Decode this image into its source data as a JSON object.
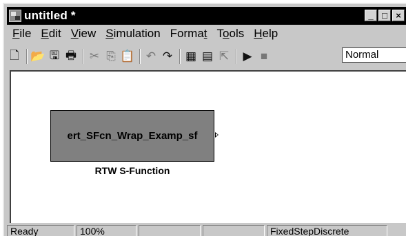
{
  "window": {
    "title": "untitled *",
    "controls": {
      "minimize": "_",
      "maximize": "□",
      "close": "×"
    }
  },
  "menu": [
    "File",
    "Edit",
    "View",
    "Simulation",
    "Format",
    "Tools",
    "Help"
  ],
  "menu_access": [
    "F",
    "E",
    "V",
    "S",
    "t",
    "o",
    "H"
  ],
  "toolbar": {
    "icons": [
      {
        "name": "new-model-icon",
        "glyph": "🗋"
      },
      {
        "name": "open-icon",
        "glyph": "📂"
      },
      {
        "name": "save-icon",
        "glyph": "🖫"
      },
      {
        "name": "print-icon",
        "glyph": "🖶"
      },
      {
        "name": "cut-icon",
        "glyph": "✂"
      },
      {
        "name": "copy-icon",
        "glyph": "⎘"
      },
      {
        "name": "paste-icon",
        "glyph": "📋"
      },
      {
        "name": "undo-icon",
        "glyph": "↶"
      },
      {
        "name": "redo-icon",
        "glyph": "↷"
      },
      {
        "name": "library-browser-icon",
        "glyph": "▦"
      },
      {
        "name": "model-browser-icon",
        "glyph": "▤"
      },
      {
        "name": "go-to-parent-icon",
        "glyph": "⇱"
      },
      {
        "name": "start-simulation-icon",
        "glyph": "▶"
      },
      {
        "name": "stop-simulation-icon",
        "glyph": "■"
      }
    ],
    "simulation_mode": "Normal"
  },
  "canvas": {
    "block_label": "ert_SFcn_Wrap_Examp_sf",
    "block_caption": "RTW S-Function"
  },
  "status": {
    "state": "Ready",
    "zoom": "100%",
    "empty1": "",
    "empty2": "",
    "solver": "FixedStepDiscrete"
  }
}
